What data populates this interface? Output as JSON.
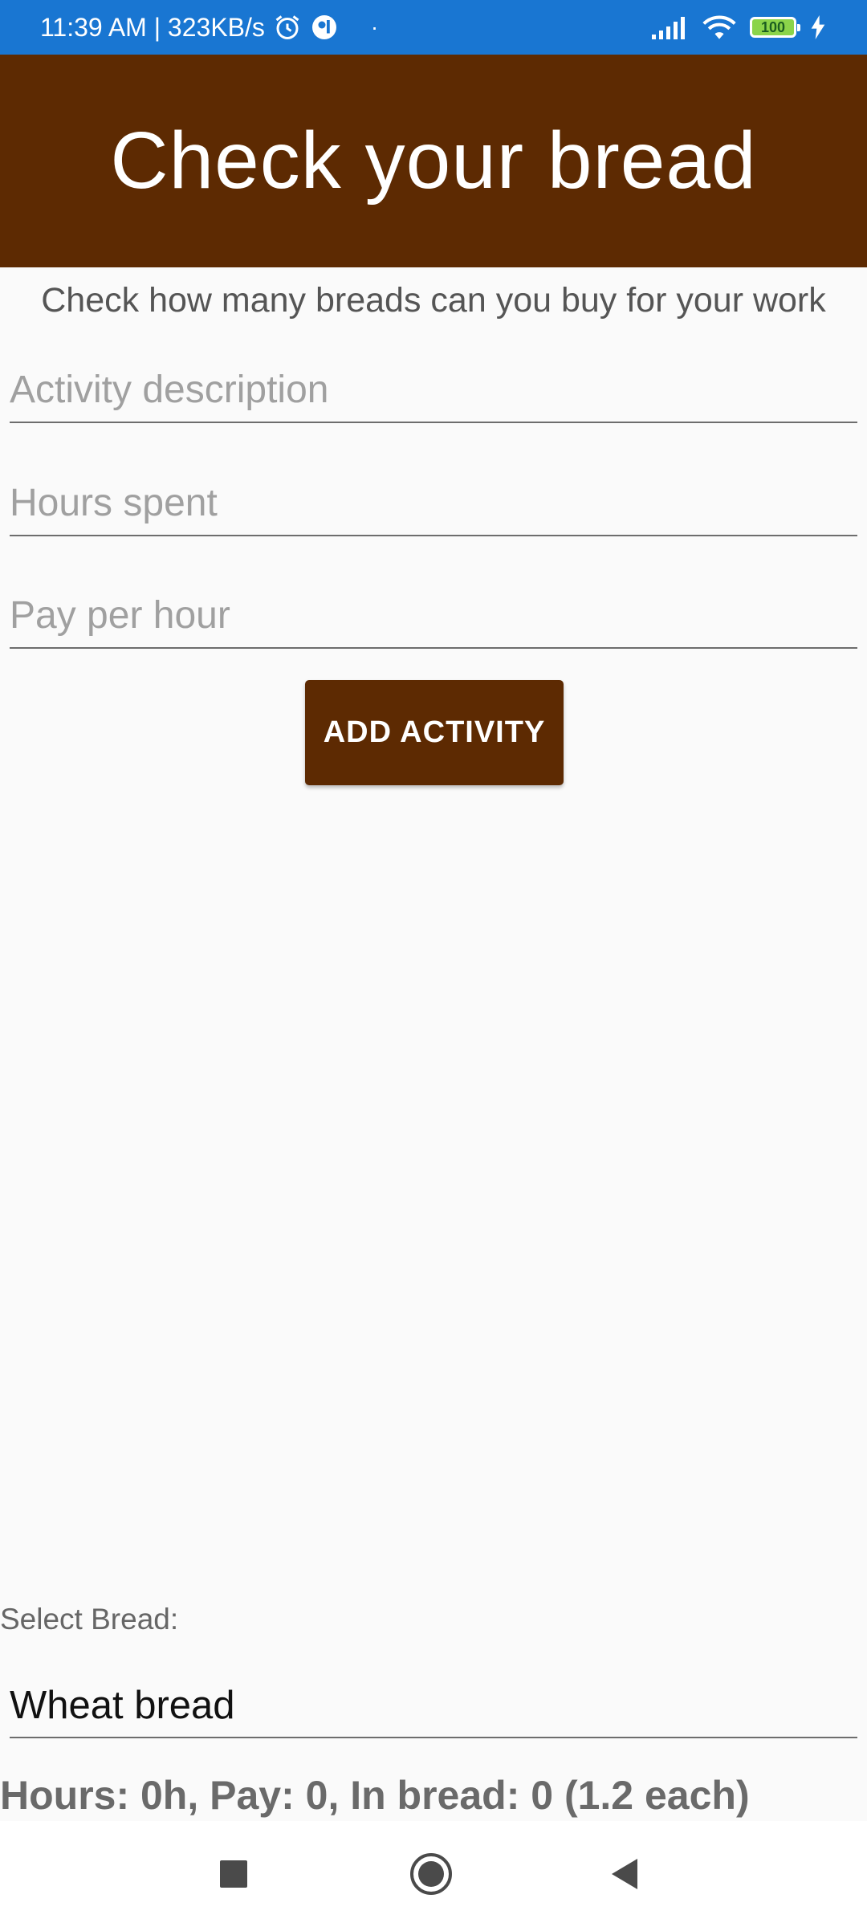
{
  "status_bar": {
    "time_speed": "11:39 AM | 323KB/s",
    "dot": "·",
    "battery_level": "100",
    "icons": [
      "alarm-icon",
      "app-notification-icon",
      "signal-icon",
      "wifi-icon",
      "battery-icon",
      "charging-icon"
    ]
  },
  "app_bar": {
    "title": "Check your bread",
    "color": "#5d2a02"
  },
  "main": {
    "subtitle": "Check how many breads can you buy for your work",
    "fields": [
      {
        "placeholder": "Activity description",
        "value": ""
      },
      {
        "placeholder": "Hours spent",
        "value": ""
      },
      {
        "placeholder": "Pay per hour",
        "value": ""
      }
    ],
    "add_button_label": "ADD ACTIVITY"
  },
  "bread_select": {
    "label": "Select Bread:",
    "selected": "Wheat bread"
  },
  "summary": {
    "text": "Hours: 0h, Pay: 0, In bread: 0 (1.2 each)"
  },
  "nav_bar": {
    "icons": [
      "recents-icon",
      "home-icon",
      "back-icon"
    ]
  },
  "colors": {
    "status_bar": "#1976d2",
    "brand_brown": "#5d2a02",
    "background": "#fafafa"
  }
}
